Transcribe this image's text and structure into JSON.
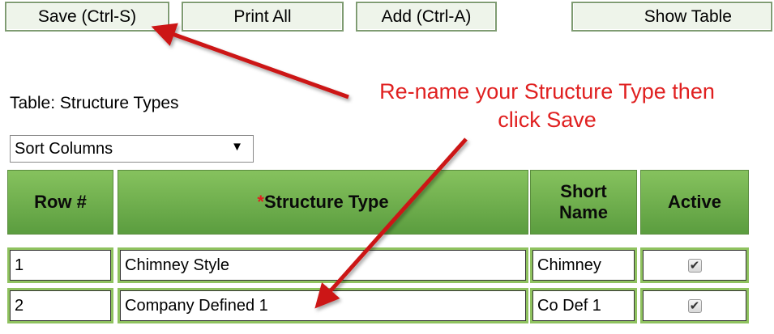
{
  "toolbar": {
    "save_label": "Save (Ctrl-S)",
    "print_label": "Print All",
    "add_label": "Add (Ctrl-A)",
    "show_table_label": "Show Table"
  },
  "table_caption": "Table: Structure Types",
  "sort_select": {
    "selected": "Sort Columns",
    "arrow": "▼"
  },
  "columns": {
    "row_num": "Row #",
    "required_marker": "*",
    "structure_type": "Structure Type",
    "short_name_1": "Short",
    "short_name_2": "Name",
    "active": "Active"
  },
  "rows": [
    {
      "row": "1",
      "structure_type": "Chimney Style",
      "short_name": "Chimney",
      "active": true
    },
    {
      "row": "2",
      "structure_type": "Company Defined 1",
      "short_name": "Co Def 1",
      "active": true
    }
  ],
  "annotation": {
    "line1": "Re-name your Structure Type then",
    "line2": "click Save",
    "color": "#e02020"
  },
  "colors": {
    "header_green": "#6aae4a",
    "cell_border_green": "#8fc25f",
    "button_bg": "#eef4ea"
  }
}
